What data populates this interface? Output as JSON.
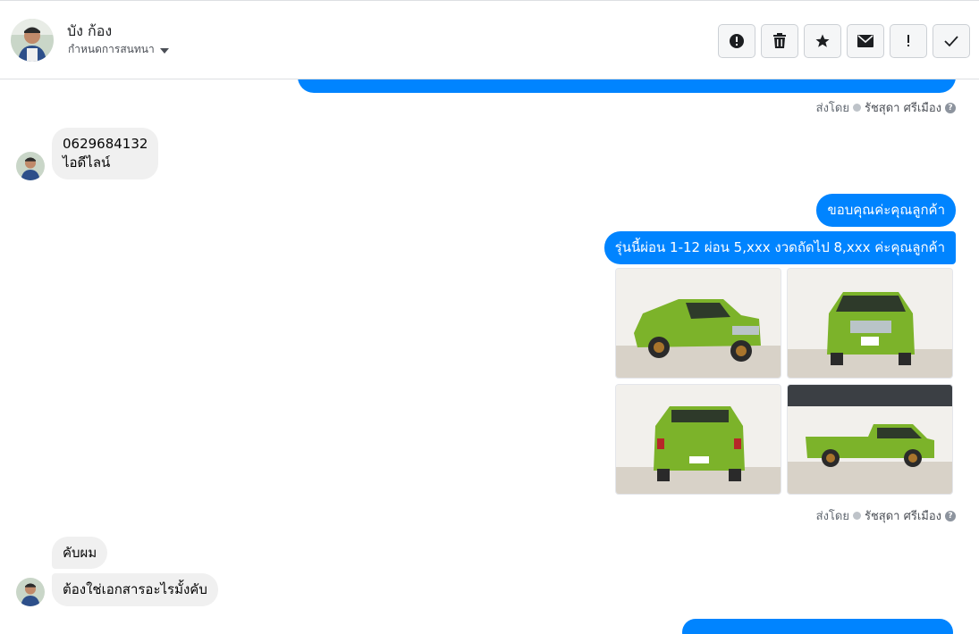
{
  "header": {
    "contact_name": "บัง ก้อง",
    "assign_label": "กำหนดการสนทนา"
  },
  "toolbar": {
    "buttons": [
      "alert-circle-icon",
      "trash-icon",
      "star-icon",
      "envelope-icon",
      "exclamation-icon",
      "check-icon"
    ]
  },
  "colors": {
    "accent": "#0084ff",
    "incoming_bg": "#f0f0f0"
  },
  "messages": {
    "sent_by_1": {
      "prefix": "ส่งโดย",
      "name": "รัชสุดา ศรีเมือง"
    },
    "incoming_1": {
      "line1": "0629684132",
      "line2": "ไอดีไลน์"
    },
    "outgoing_2": "ขอบคุณค่ะคุณลูกค้า",
    "outgoing_3": "รุ่นนี้ผ่อน 1-12 ผ่อน  5,xxx งวดถัดไป 8,xxx ค่ะคุณลูกค้า",
    "photos": [
      "green-pickup-front-left",
      "green-pickup-front",
      "green-pickup-rear",
      "green-pickup-side"
    ],
    "sent_by_2": {
      "prefix": "ส่งโดย",
      "name": "รัชสุดา ศรีเมือง"
    },
    "incoming_2": "คับผม",
    "incoming_3": "ต้องใช่เอกสารอะไรมั้งคับ"
  }
}
